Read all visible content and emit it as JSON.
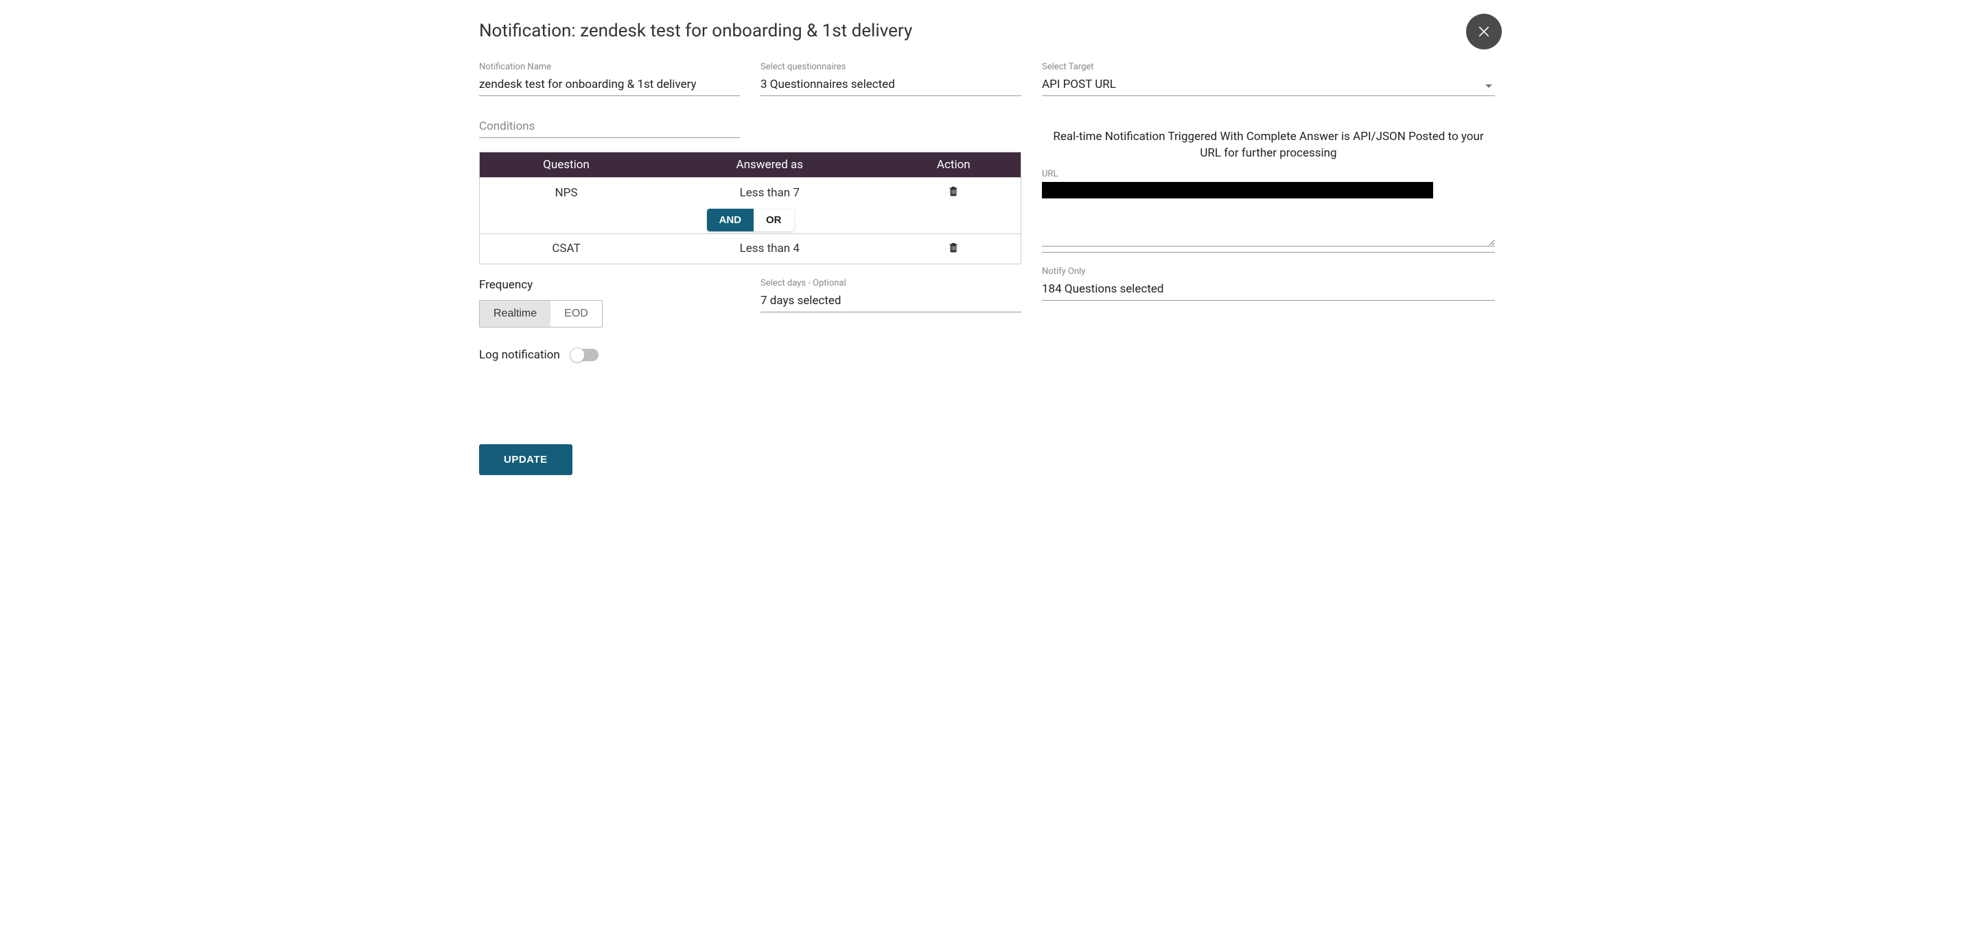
{
  "title_prefix": "Notification: ",
  "title_name": "zendesk test for onboarding & 1st delivery",
  "fields": {
    "name_label": "Notification Name",
    "name_value": "zendesk test for onboarding & 1st delivery",
    "questionnaires_label": "Select questionnaires",
    "questionnaires_value": "3 Questionnaires selected",
    "target_label": "Select Target",
    "target_value": "API POST URL",
    "conditions_label": "Conditions",
    "days_label": "Select days - Optional",
    "days_value": "7 days selected",
    "url_label": "URL",
    "notify_label": "Notify Only",
    "notify_value": "184 Questions selected"
  },
  "target_description": "Real-time Notification Triggered With Complete Answer is API/JSON Posted to your URL for further processing",
  "cond_headers": {
    "question": "Question",
    "answered": "Answered as",
    "action": "Action"
  },
  "conditions": [
    {
      "question": "NPS",
      "answered": "Less than  7"
    },
    {
      "question": "CSAT",
      "answered": "Less than  4"
    }
  ],
  "operator": {
    "and": "AND",
    "or": "OR",
    "active": "AND"
  },
  "frequency": {
    "label": "Frequency",
    "realtime": "Realtime",
    "eod": "EOD",
    "active": "Realtime"
  },
  "log_label": "Log notification",
  "log_on": false,
  "update_label": "UPDATE"
}
